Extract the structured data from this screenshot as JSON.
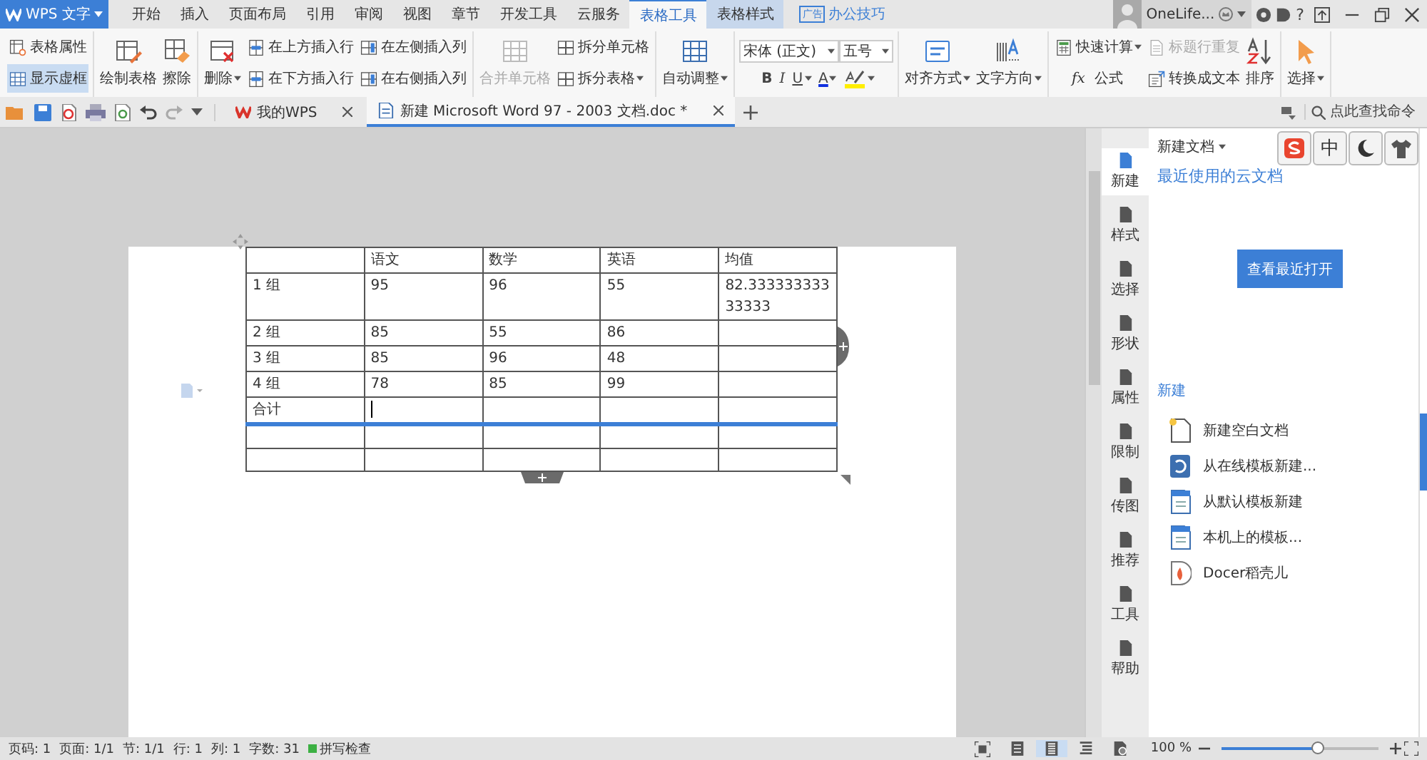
{
  "app_button": {
    "label": "WPS 文字"
  },
  "ribbon_tabs": [
    {
      "label": "开始",
      "selected": false,
      "kind": "standard"
    },
    {
      "label": "插入",
      "selected": false,
      "kind": "standard"
    },
    {
      "label": "页面布局",
      "selected": false,
      "kind": "standard"
    },
    {
      "label": "引用",
      "selected": false,
      "kind": "standard"
    },
    {
      "label": "审阅",
      "selected": false,
      "kind": "standard"
    },
    {
      "label": "视图",
      "selected": false,
      "kind": "standard"
    },
    {
      "label": "章节",
      "selected": false,
      "kind": "standard"
    },
    {
      "label": "开发工具",
      "selected": false,
      "kind": "standard"
    },
    {
      "label": "云服务",
      "selected": false,
      "kind": "standard"
    },
    {
      "label": "表格工具",
      "selected": true,
      "kind": "contextual"
    },
    {
      "label": "表格样式",
      "selected": false,
      "kind": "contextual"
    }
  ],
  "ad": {
    "badge": "广告",
    "label": "办公技巧"
  },
  "account": {
    "name": "OneLife..."
  },
  "help": {
    "label": "?"
  },
  "ribbon_groups": [
    {
      "kind": "buttons",
      "items": [
        {
          "label": "表格属性",
          "kind": "properties",
          "on": false,
          "disabled": false,
          "dropdown": false
        },
        {
          "label": "显示虚框",
          "kind": "gridlines",
          "on": true,
          "disabled": false,
          "dropdown": false
        }
      ]
    },
    {
      "kind": "buttons",
      "items": [
        {
          "label": "绘制表格",
          "kind": "draw",
          "on": false,
          "disabled": false,
          "dropdown": false
        },
        {
          "label": "擦除",
          "kind": "erase",
          "on": false,
          "disabled": false,
          "dropdown": false
        }
      ]
    },
    {
      "kind": "buttons",
      "items": [
        {
          "label": "删除",
          "kind": "delete",
          "on": false,
          "disabled": false,
          "dropdown": true
        },
        {
          "label": "在上方插入行",
          "kind": "insertrow",
          "on": false,
          "disabled": false,
          "dropdown": false
        },
        {
          "label": "在下方插入行",
          "kind": "insertrow",
          "on": false,
          "disabled": false,
          "dropdown": false
        },
        {
          "label": "在左侧插入列",
          "kind": "insertcol",
          "on": false,
          "disabled": false,
          "dropdown": false
        },
        {
          "label": "在右侧插入列",
          "kind": "insertcol",
          "on": false,
          "disabled": false,
          "dropdown": false
        }
      ]
    },
    {
      "kind": "buttons",
      "items": [
        {
          "label": "合并单元格",
          "kind": "merge",
          "on": false,
          "disabled": true,
          "dropdown": false
        },
        {
          "label": "拆分单元格",
          "kind": "split",
          "on": false,
          "disabled": false,
          "dropdown": false
        },
        {
          "label": "拆分表格",
          "kind": "split",
          "on": false,
          "disabled": false,
          "dropdown": true
        }
      ]
    },
    {
      "kind": "buttons",
      "items": [
        {
          "label": "自动调整",
          "kind": "autofit",
          "on": false,
          "disabled": false,
          "dropdown": true
        }
      ]
    },
    {
      "kind": "font",
      "family": "宋体 (正文)",
      "size": "五号",
      "format": [
        {
          "label": "B",
          "kind": "bold"
        },
        {
          "label": "I",
          "kind": "italic"
        },
        {
          "label": "U",
          "kind": "underline"
        },
        {
          "label": "A",
          "kind": "fontcolor"
        },
        {
          "kind": "highlight"
        }
      ]
    },
    {
      "kind": "buttons",
      "items": [
        {
          "label": "对齐方式",
          "kind": "align",
          "on": false,
          "disabled": false,
          "dropdown": true
        },
        {
          "label": "文字方向",
          "kind": "direction",
          "on": false,
          "disabled": false,
          "dropdown": true
        }
      ]
    },
    {
      "kind": "buttons",
      "items": [
        {
          "label": "快速计算",
          "kind": "calc",
          "on": false,
          "disabled": false,
          "dropdown": true
        },
        {
          "label": "公式",
          "kind": "formula",
          "symbol": "fx",
          "on": false,
          "disabled": false,
          "dropdown": false
        },
        {
          "label": "标题行重复",
          "kind": "repeat",
          "on": false,
          "disabled": true,
          "dropdown": false
        },
        {
          "label": "转换成文本",
          "kind": "totext",
          "on": false,
          "disabled": false,
          "dropdown": false
        },
        {
          "label": "排序",
          "kind": "sort",
          "on": false,
          "disabled": false,
          "dropdown": false
        }
      ]
    },
    {
      "kind": "buttons",
      "items": [
        {
          "label": "选择",
          "kind": "select",
          "on": false,
          "disabled": false,
          "dropdown": true
        }
      ]
    }
  ],
  "doc_tabs": [
    {
      "label": "我的WPS",
      "selected": false,
      "kind": "home"
    },
    {
      "label": "新建 Microsoft Word 97 - 2003 文档.doc *",
      "selected": true,
      "kind": "document"
    }
  ],
  "command_search": {
    "placeholder": "点此查找命令"
  },
  "table": {
    "columns": [
      null,
      "语文",
      "数学",
      "英语",
      "均值"
    ],
    "rows": [
      {
        "cells": [
          "1 组",
          "95",
          "96",
          "55",
          "82.33333333333333"
        ],
        "active": false
      },
      {
        "cells": [
          "2 组",
          "85",
          "55",
          "86",
          null
        ],
        "active": false
      },
      {
        "cells": [
          "3 组",
          "85",
          "96",
          "48",
          null
        ],
        "active": false
      },
      {
        "cells": [
          "4 组",
          "78",
          "85",
          "99",
          null
        ],
        "active": false
      },
      {
        "cells": [
          "合计",
          null,
          null,
          null,
          null
        ],
        "active": true
      },
      {
        "cells": [
          null,
          null,
          null,
          null,
          null
        ],
        "active": false
      },
      {
        "cells": [
          null,
          null,
          null,
          null,
          null
        ],
        "active": false
      }
    ]
  },
  "task_nav": [
    {
      "label": "新建",
      "selected": true
    },
    {
      "label": "样式",
      "selected": false
    },
    {
      "label": "选择",
      "selected": false
    },
    {
      "label": "形状",
      "selected": false
    },
    {
      "label": "属性",
      "selected": false
    },
    {
      "label": "限制",
      "selected": false
    },
    {
      "label": "传图",
      "selected": false
    },
    {
      "label": "推荐",
      "selected": false
    },
    {
      "label": "工具",
      "selected": false
    },
    {
      "label": "帮助",
      "selected": false
    }
  ],
  "task_pane": {
    "title": "新建文档",
    "cloud_link": "最近使用的云文档",
    "recent_button": "查看最近打开",
    "section": "新建",
    "items": [
      {
        "label": "新建空白文档",
        "kind": "blank"
      },
      {
        "label": "从在线模板新建...",
        "kind": "online"
      },
      {
        "label": "从默认模板新建",
        "kind": "default"
      },
      {
        "label": "本机上的模板...",
        "kind": "local"
      },
      {
        "label": "Docer稻壳儿",
        "kind": "docer"
      }
    ]
  },
  "ime_bar": [
    {
      "kind": "logo"
    },
    {
      "kind": "text",
      "label": "中"
    },
    {
      "kind": "moon"
    },
    {
      "kind": "shirt"
    }
  ],
  "status": {
    "items": [
      "页码: 1",
      "页面: 1/1",
      "节: 1/1",
      "行: 1",
      "列: 1",
      "字数: 31"
    ],
    "spell_check": "拼写检查",
    "view_modes": [
      {
        "kind": "focus",
        "selected": false
      },
      {
        "kind": "page",
        "selected": true
      },
      {
        "kind": "outline",
        "selected": false
      },
      {
        "kind": "web",
        "selected": false
      }
    ],
    "zoom": "100 %",
    "zoom_slider": {
      "level": 0.62
    }
  }
}
